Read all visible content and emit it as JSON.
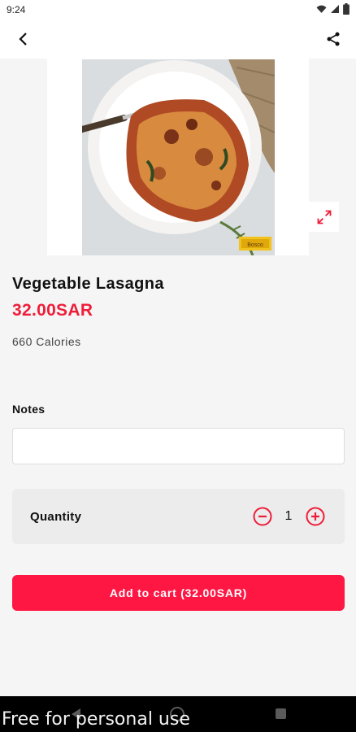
{
  "status_bar": {
    "time": "9:24"
  },
  "product": {
    "name": "Vegetable Lasagna",
    "price": "32.00SAR",
    "calories": "660 Calories",
    "image_tag": "Bosco"
  },
  "notes": {
    "label": "Notes",
    "value": "",
    "placeholder": ""
  },
  "quantity": {
    "label": "Quantity",
    "value": "1"
  },
  "cart": {
    "button_label": "Add to cart (32.00SAR)"
  },
  "watermark": "Free for personal use",
  "colors": {
    "accent": "#ff1744",
    "price": "#ee1e3a",
    "background": "#f5f5f5"
  },
  "icons": {
    "back": "arrow-back-icon",
    "share": "share-icon",
    "expand": "expand-icon",
    "minus": "minus-circle-icon",
    "plus": "plus-circle-icon"
  }
}
